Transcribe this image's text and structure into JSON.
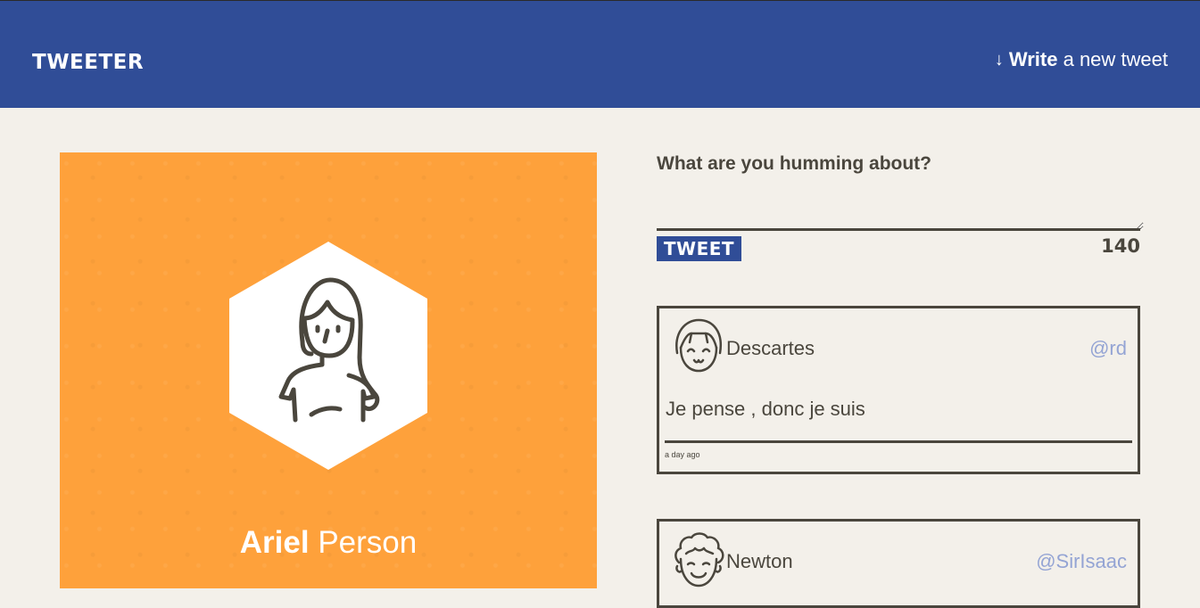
{
  "header": {
    "brand": "TWEETER",
    "compose_arrow": "↓",
    "compose_bold": "Write",
    "compose_rest": "a new tweet"
  },
  "profile": {
    "first_name": "Ariel",
    "last_name": "Person",
    "avatar_icon": "woman-avatar-icon",
    "background_color": "#fea13b"
  },
  "compose": {
    "question": "What are you humming about?",
    "input_value": "",
    "button_label": "TWEET",
    "counter": "140"
  },
  "tweets": [
    {
      "author": "Descartes",
      "handle": "@rd",
      "content": "Je pense , donc je suis",
      "time": "a day ago",
      "avatar_icon": "smiling-girl-avatar-icon"
    },
    {
      "author": "Newton",
      "handle": "@SirIsaac",
      "avatar_icon": "curly-hair-man-avatar-icon"
    }
  ],
  "colors": {
    "header_bg": "#304d97",
    "page_bg": "#f3f0ea",
    "text": "#4a463d",
    "handle": "#94a4d4",
    "accent": "#fea13b"
  }
}
